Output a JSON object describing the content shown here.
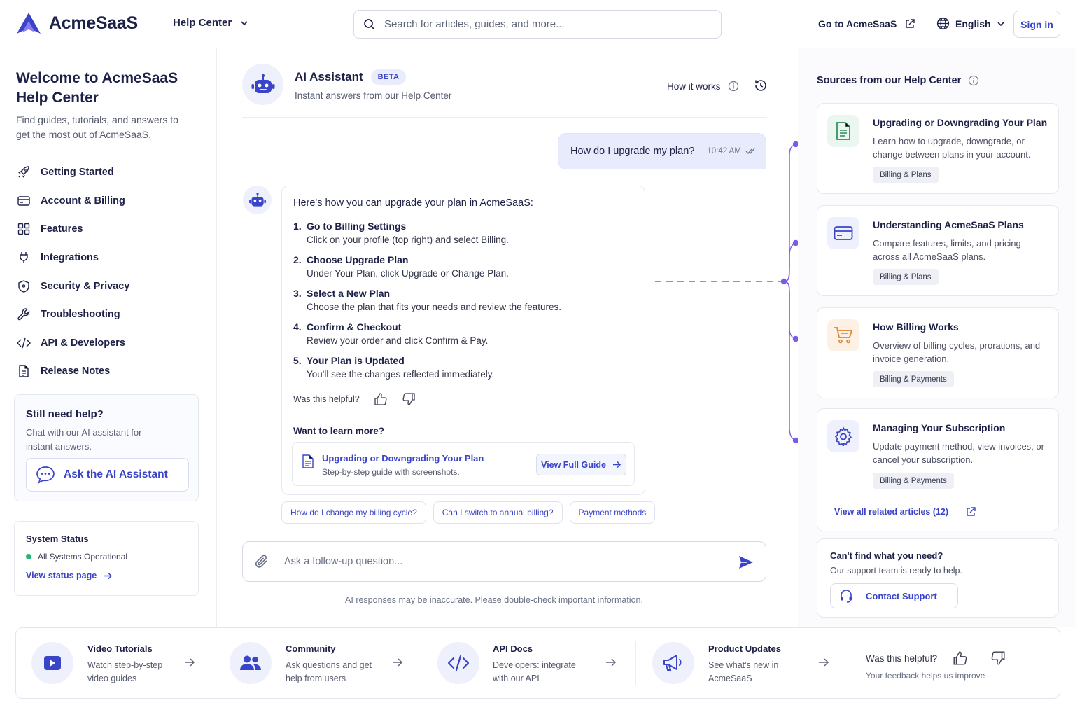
{
  "header": {
    "logo_text": "AcmeSaaS",
    "help_center": "Help Center",
    "search_placeholder": "Search for articles, guides, and more...",
    "goto_label": "Go to AcmeSaaS",
    "language": "English",
    "signin_label": "Sign in"
  },
  "sidebar": {
    "title": "Welcome to AcmeSaaS Help Center",
    "subtitle": "Find guides, tutorials, and answers to get the most out of AcmeSaaS.",
    "items": [
      {
        "label": "Getting Started",
        "icon": "rocket-icon"
      },
      {
        "label": "Account & Billing",
        "icon": "card-icon"
      },
      {
        "label": "Features",
        "icon": "grid-icon"
      },
      {
        "label": "Integrations",
        "icon": "plug-icon"
      },
      {
        "label": "Security & Privacy",
        "icon": "shield-icon"
      },
      {
        "label": "Troubleshooting",
        "icon": "wrench-icon"
      },
      {
        "label": "API & Developers",
        "icon": "code-icon"
      },
      {
        "label": "Release Notes",
        "icon": "document-icon"
      }
    ],
    "still_help": {
      "title": "Still need help?",
      "text": "Chat with our AI assistant for instant answers.",
      "button": "Ask the AI Assistant"
    },
    "system_status": {
      "title": "System Status",
      "status": "All Systems Operational",
      "status_color": "#22b573",
      "link": "View status page"
    }
  },
  "chat": {
    "assistant_name": "AI Assistant",
    "badge": "BETA",
    "subtitle": "Instant answers from our Help Center",
    "how_it_works": "How it works",
    "user_message": "How do I upgrade my plan?",
    "user_time": "10:42 AM",
    "answer_intro": "Here's how you can upgrade your plan in AcmeSaaS:",
    "steps": [
      {
        "num": "1.",
        "title": "Go to Billing Settings",
        "desc": "Click on your profile (top right) and select Billing."
      },
      {
        "num": "2.",
        "title": "Choose Upgrade Plan",
        "desc": "Under Your Plan, click Upgrade or Change Plan."
      },
      {
        "num": "3.",
        "title": "Select a New Plan",
        "desc": "Choose the plan that fits your needs and review the features."
      },
      {
        "num": "4.",
        "title": "Confirm & Checkout",
        "desc": "Review your order and click Confirm & Pay."
      },
      {
        "num": "5.",
        "title": "Your Plan is Updated",
        "desc": "You'll see the changes reflected immediately."
      }
    ],
    "helpful": "Was this helpful?",
    "learn_more": "Want to learn more?",
    "guide": {
      "title": "Upgrading or Downgrading Your Plan",
      "subtitle": "Step-by-step guide with screenshots.",
      "button": "View Full Guide"
    },
    "suggestions": [
      "How do I change my billing cycle?",
      "Can I switch to annual billing?",
      "Payment methods"
    ],
    "input_placeholder": "Ask a follow-up question...",
    "disclaimer": "AI responses may be inaccurate. Please double-check important information."
  },
  "sources": {
    "title": "Sources from our Help Center",
    "accent_color": "#7b5ce0",
    "cards": [
      {
        "title": "Upgrading or Downgrading Your Plan",
        "desc": "Learn how to upgrade, downgrade, or change between plans in your account.",
        "tag": "Billing & Plans",
        "icon": "document-icon"
      },
      {
        "title": "Understanding AcmeSaaS Plans",
        "desc": "Compare features, limits, and pricing across all AcmeSaaS plans.",
        "tag": "Billing & Plans",
        "icon": "card-icon"
      },
      {
        "title": "How Billing Works",
        "desc": "Overview of billing cycles, prorations, and invoice generation.",
        "tag": "Billing & Payments",
        "icon": "cart-icon"
      },
      {
        "title": "Managing Your Subscription",
        "desc": "Update payment method, view invoices, or cancel your subscription.",
        "tag": "Billing & Payments",
        "icon": "gear-icon"
      }
    ],
    "related_link": "View all related articles (12)",
    "cant_find": {
      "title": "Can't find what you need?",
      "text": "Our support team is ready to help.",
      "button": "Contact Support"
    }
  },
  "footer": {
    "items": [
      {
        "title": "Video Tutorials",
        "desc": "Watch step-by-step video guides",
        "icon": "video-icon"
      },
      {
        "title": "Community",
        "desc": "Ask questions and get help from users",
        "icon": "users-icon"
      },
      {
        "title": "API Docs",
        "desc": "Developers: integrate with our API",
        "icon": "code-icon"
      },
      {
        "title": "Product Updates",
        "desc": "See what's new in AcmeSaaS",
        "icon": "megaphone-icon"
      }
    ],
    "helpful": "Was this helpful?",
    "helpful_sub": "Your feedback helps us improve"
  },
  "colors": {
    "brand": "#3a44c9",
    "text": "#1d2147"
  }
}
